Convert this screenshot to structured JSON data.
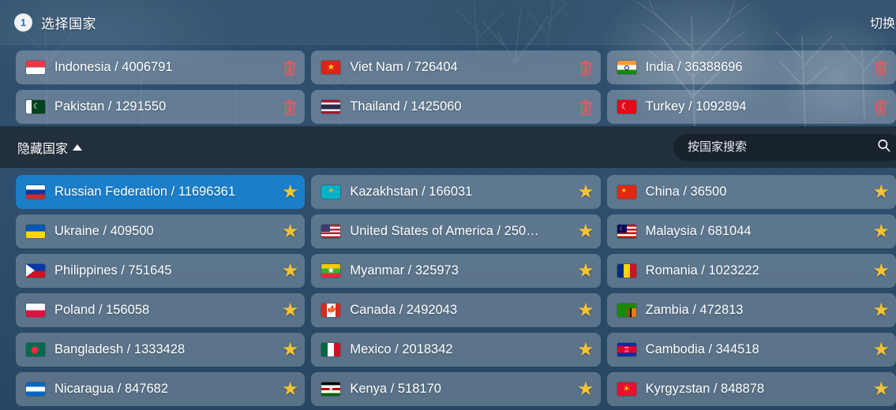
{
  "header": {
    "step_number": "1",
    "step_title": "选择国家",
    "switch_label": "切换"
  },
  "selected_countries": [
    {
      "name": "Indonesia",
      "value": "4006791",
      "label": "Indonesia / 4006791",
      "flag": "id"
    },
    {
      "name": "Viet Nam",
      "value": "726404",
      "label": "Viet Nam / 726404",
      "flag": "vn"
    },
    {
      "name": "India",
      "value": "36388696",
      "label": "India / 36388696",
      "flag": "in"
    },
    {
      "name": "Pakistan",
      "value": "1291550",
      "label": "Pakistan / 1291550",
      "flag": "pk"
    },
    {
      "name": "Thailand",
      "value": "1425060",
      "label": "Thailand / 1425060",
      "flag": "th"
    },
    {
      "name": "Turkey",
      "value": "1092894",
      "label": "Turkey / 1092894",
      "flag": "tr"
    }
  ],
  "subbar": {
    "hide_label": "隐藏国家",
    "caret": "▲"
  },
  "search": {
    "placeholder": "按国家搜索",
    "value": "",
    "icon": "search-icon"
  },
  "country_list": [
    {
      "name": "Russian Federation",
      "value": "11696361",
      "label": "Russian Federation / 11696361",
      "flag": "ru",
      "selected": true,
      "starred": true
    },
    {
      "name": "Kazakhstan",
      "value": "166031",
      "label": "Kazakhstan / 166031",
      "flag": "kz",
      "selected": false,
      "starred": true
    },
    {
      "name": "China",
      "value": "36500",
      "label": "China / 36500",
      "flag": "cn",
      "selected": false,
      "starred": true
    },
    {
      "name": "Ukraine",
      "value": "409500",
      "label": "Ukraine / 409500",
      "flag": "ua",
      "selected": false,
      "starred": true
    },
    {
      "name": "United States of America",
      "value": "250...",
      "label": "United States of America / 250…",
      "flag": "us",
      "selected": false,
      "starred": true
    },
    {
      "name": "Malaysia",
      "value": "681044",
      "label": "Malaysia / 681044",
      "flag": "my",
      "selected": false,
      "starred": true
    },
    {
      "name": "Philippines",
      "value": "751645",
      "label": "Philippines / 751645",
      "flag": "ph",
      "selected": false,
      "starred": true
    },
    {
      "name": "Myanmar",
      "value": "325973",
      "label": "Myanmar / 325973",
      "flag": "mm",
      "selected": false,
      "starred": true
    },
    {
      "name": "Romania",
      "value": "1023222",
      "label": "Romania / 1023222",
      "flag": "ro",
      "selected": false,
      "starred": true
    },
    {
      "name": "Poland",
      "value": "156058",
      "label": "Poland / 156058",
      "flag": "pl",
      "selected": false,
      "starred": true
    },
    {
      "name": "Canada",
      "value": "2492043",
      "label": "Canada / 2492043",
      "flag": "ca",
      "selected": false,
      "starred": true
    },
    {
      "name": "Zambia",
      "value": "472813",
      "label": "Zambia / 472813",
      "flag": "zm",
      "selected": false,
      "starred": true
    },
    {
      "name": "Bangladesh",
      "value": "1333428",
      "label": "Bangladesh / 1333428",
      "flag": "bd",
      "selected": false,
      "starred": true
    },
    {
      "name": "Mexico",
      "value": "2018342",
      "label": "Mexico / 2018342",
      "flag": "mx",
      "selected": false,
      "starred": true
    },
    {
      "name": "Cambodia",
      "value": "344518",
      "label": "Cambodia / 344518",
      "flag": "kh",
      "selected": false,
      "starred": true
    },
    {
      "name": "Nicaragua",
      "value": "847682",
      "label": "Nicaragua / 847682",
      "flag": "ni",
      "selected": false,
      "starred": true
    },
    {
      "name": "Kenya",
      "value": "518170",
      "label": "Kenya / 518170",
      "flag": "ke",
      "selected": false,
      "starred": true
    },
    {
      "name": "Kyrgyzstan",
      "value": "848878",
      "label": "Kyrgyzstan / 848878",
      "flag": "kg",
      "selected": false,
      "starred": true
    }
  ],
  "icons": {
    "trash": "trash-icon",
    "star": "★"
  },
  "colors": {
    "selected_row": "#1b7ec9",
    "star": "#f3c333",
    "trash": "#ef5959",
    "subbar_bg": "#22303e",
    "search_bg": "#18222d"
  }
}
